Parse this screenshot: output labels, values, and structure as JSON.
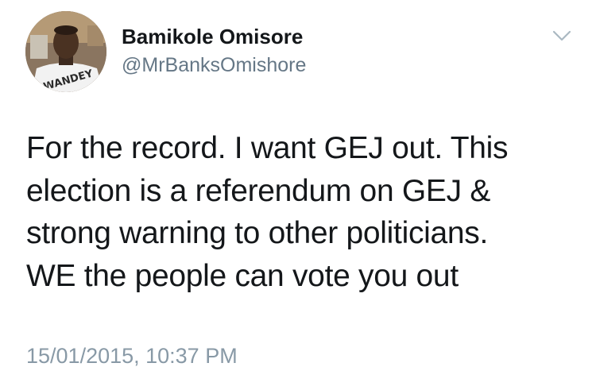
{
  "author": {
    "display_name": "Bamikole Omisore",
    "handle": "@MrBanksOmishore",
    "avatar_shirt_text": "WANDEY"
  },
  "menu": {
    "icon": "chevron-down-icon"
  },
  "tweet": {
    "lines": [
      "For the record. I want GEJ out. This",
      "election is a referendum on GEJ &",
      "strong warning to other politicians.",
      "WE the people can vote you out"
    ],
    "timestamp": "15/01/2015, 10:37 PM"
  },
  "colors": {
    "primary_text": "#14171a",
    "secondary_text": "#657786",
    "timestamp_text": "#8899a6",
    "chevron": "#aab8c2",
    "background": "#ffffff"
  }
}
